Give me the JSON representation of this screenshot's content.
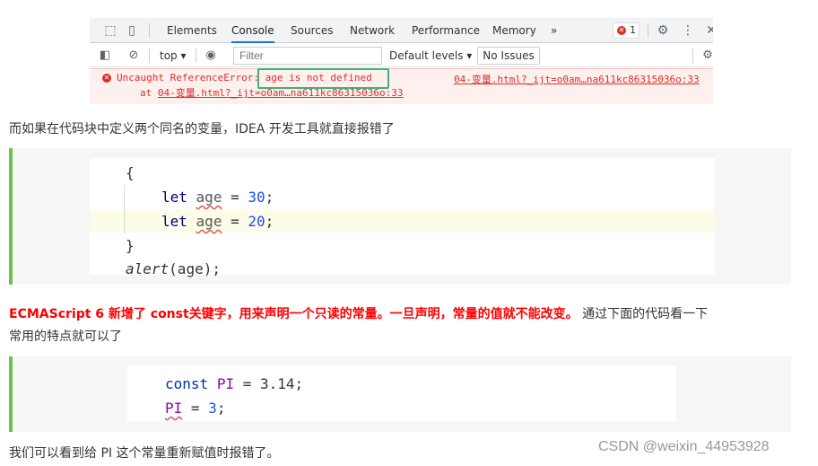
{
  "devtools": {
    "tabs": [
      "Elements",
      "Console",
      "Sources",
      "Network",
      "Performance",
      "Memory"
    ],
    "more_tabs": "»",
    "error_count": "1",
    "context": "top ▾",
    "filter_placeholder": "Filter",
    "default_levels": "Default levels ▾",
    "issues": "No Issues",
    "error": {
      "prefix": "Uncaught ReferenceError: ",
      "message": "age is not defined",
      "at_prefix": "at ",
      "at_location": "04-变量.html?_ijt=o0am…na611kc86315036o:33",
      "source_link": "04-变量.html?_ijt=o0am…na611kc86315036o:33"
    }
  },
  "article": {
    "para1": "而如果在代码块中定义两个同名的变量，IDEA 开发工具就直接报错了",
    "code1": {
      "open_brace": "{",
      "kw_let": "let",
      "var_age": "age",
      "eq": " = ",
      "val1": "30",
      "val2": "20",
      "semi": ";",
      "close_brace": "}",
      "alert_fn": "alert",
      "alert_args": "(age);"
    },
    "para2_red": "ECMAScript 6 新增了 const关键字，用来声明一个只读的常量。一旦声明，常量的值就不能改变。",
    "para2_rest": " 通过下面的代码看一下",
    "para2_line2": "常用的特点就可以了",
    "code2": {
      "kw_const": "const",
      "pi": "PI",
      "eq": " = ",
      "val1": "3.14",
      "semi": ";",
      "val2": "3"
    },
    "para3": "我们可以看到给 PI 这个常量重新赋值时报错了。",
    "watermark": "CSDN @weixin_44953928"
  }
}
